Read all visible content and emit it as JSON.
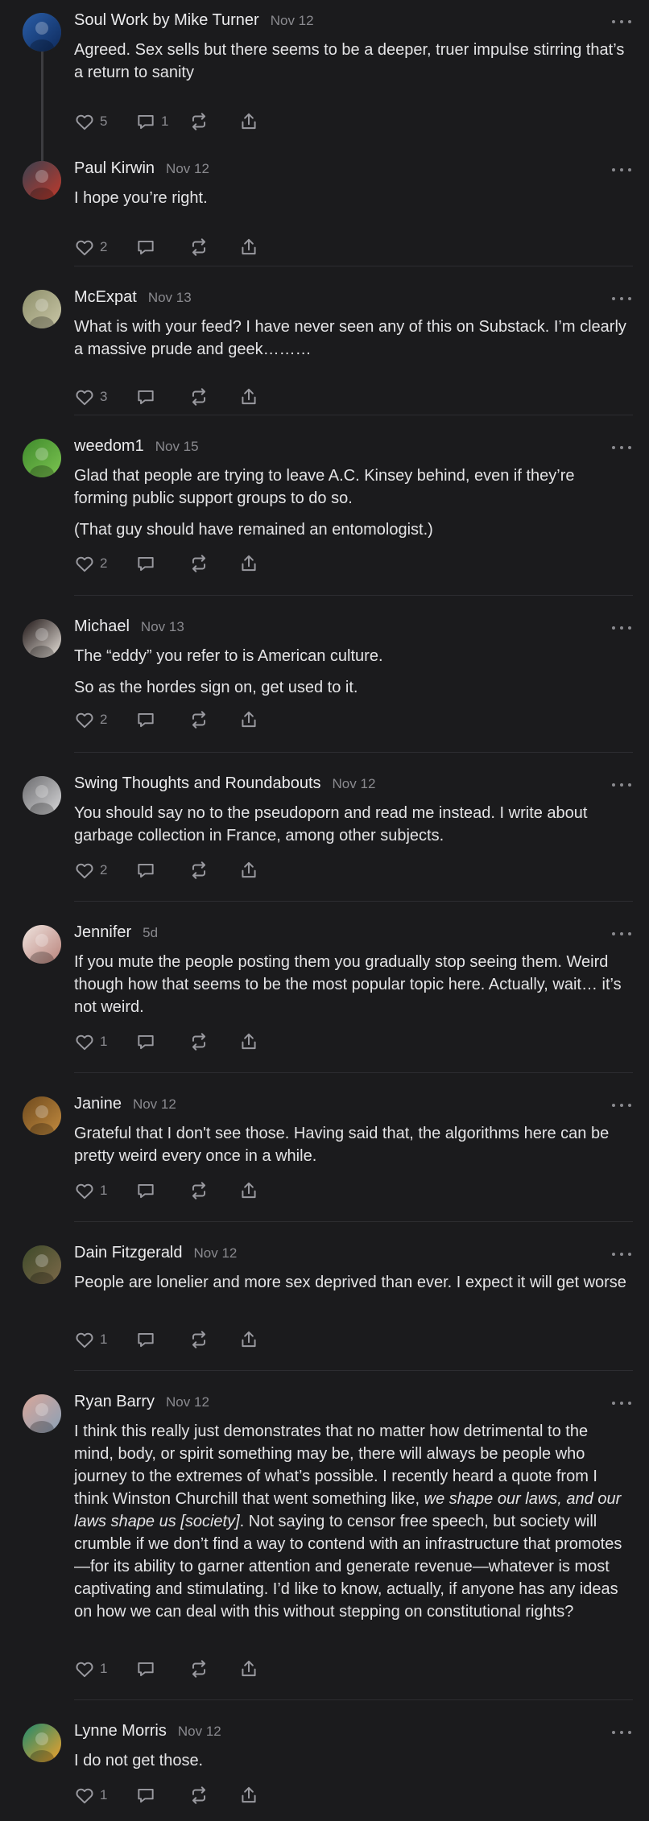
{
  "comments": [
    {
      "author": "Soul Work by Mike Turner",
      "date": "Nov 12",
      "avatar": "avatar-blue-suit",
      "avatar_colors": [
        "#2a5ea8",
        "#0e2a5c"
      ],
      "paragraphs": [
        "Agreed. Sex sells but there seems to be a deeper, truer impulse stirring that’s a return to sanity"
      ],
      "likes": "5",
      "replies": "1"
    },
    {
      "author": "Paul Kirwin",
      "date": "Nov 12",
      "avatar": "avatar-red-figure",
      "avatar_colors": [
        "#3a4150",
        "#c0392b"
      ],
      "paragraphs": [
        "I hope you’re right."
      ],
      "likes": "2",
      "replies": ""
    },
    {
      "author": "McExpat",
      "date": "Nov 13",
      "avatar": "avatar-landscape",
      "avatar_colors": [
        "#8d8f6b",
        "#c9c6a6"
      ],
      "paragraphs": [
        "What is with your feed? I have never seen any of this on Substack. I’m clearly a massive prude and geek………"
      ],
      "likes": "3",
      "replies": ""
    },
    {
      "author": "weedom1",
      "date": "Nov 15",
      "avatar": "avatar-green-leaves",
      "avatar_colors": [
        "#3f8a2c",
        "#7cc451"
      ],
      "paragraphs": [
        "Glad that people are trying to leave A.C. Kinsey behind, even if they’re forming public support groups to do so.",
        "(That guy should have remained an entomologist.)"
      ],
      "likes": "2",
      "replies": ""
    },
    {
      "author": "Michael",
      "date": "Nov 13",
      "avatar": "avatar-piano",
      "avatar_colors": [
        "#1d1414",
        "#e9e3dc"
      ],
      "paragraphs": [
        "The “eddy” you refer to is American culture.",
        "So as the hordes sign on, get used to it."
      ],
      "likes": "2",
      "replies": ""
    },
    {
      "author": "Swing Thoughts and Roundabouts",
      "date": "Nov 12",
      "avatar": "avatar-statue",
      "avatar_colors": [
        "#6b6b6e",
        "#d7d7d9"
      ],
      "paragraphs": [
        "You should say no to the pseudoporn and read me instead. I write about garbage collection in France, among other subjects."
      ],
      "likes": "2",
      "replies": ""
    },
    {
      "author": "Jennifer",
      "date": "5d",
      "avatar": "avatar-woman",
      "avatar_colors": [
        "#efe4df",
        "#b9827a"
      ],
      "paragraphs": [
        "If you mute the people posting them you gradually stop seeing them. Weird though how that seems to be the most popular topic here. Actually, wait… it’s not weird."
      ],
      "likes": "1",
      "replies": ""
    },
    {
      "author": "Janine",
      "date": "Nov 12",
      "avatar": "avatar-bronze-coin",
      "avatar_colors": [
        "#6e4a1e",
        "#c38b3f"
      ],
      "paragraphs": [
        "Grateful that I don't see those. Having said that, the algorithms here can be pretty weird every once in a while."
      ],
      "likes": "1",
      "replies": ""
    },
    {
      "author": "Dain Fitzgerald",
      "date": "Nov 12",
      "avatar": "avatar-forest-man",
      "avatar_colors": [
        "#3e4a2a",
        "#7d6a4a"
      ],
      "paragraphs": [
        "People are lonelier and more sex deprived than ever. I expect it will get worse"
      ],
      "likes": "1",
      "replies": ""
    },
    {
      "author": "Ryan Barry",
      "date": "Nov 12",
      "avatar": "avatar-man-pink",
      "avatar_colors": [
        "#d9a79a",
        "#8aa0b6"
      ],
      "paragraphs": [
        [
          {
            "text": "I think this really just demonstrates that no matter how detrimental to the mind, body, or spirit something may be, there will always be people who journey to the extremes of what’s possible. I recently heard a quote from I think Winston Churchill that went something like, ",
            "italic": false
          },
          {
            "text": "we shape our laws, and our laws shape us [society]",
            "italic": true
          },
          {
            "text": ". Not saying to censor free speech, but society will crumble if we don’t find a way to contend with an infrastructure that promotes—for its ability to garner attention and generate revenue—whatever is most captivating and stimulating. I’d like to know, actually, if anyone has any ideas on how we can deal with this without stepping on constitutional rights?",
            "italic": false
          }
        ]
      ],
      "likes": "1",
      "replies": ""
    },
    {
      "author": "Lynne Morris",
      "date": "Nov 12",
      "avatar": "avatar-teal-circle",
      "avatar_colors": [
        "#1e8a6e",
        "#f0a12b"
      ],
      "paragraphs": [
        "I do not get those."
      ],
      "likes": "1",
      "replies": ""
    }
  ],
  "icons": {
    "like": "heart-icon",
    "reply": "comment-bubble-icon",
    "restack": "restack-icon",
    "share": "share-icon",
    "more": "more-options-icon"
  },
  "colors": {
    "background": "#1b1b1d",
    "text": "#e4e4e6",
    "muted": "#8a8a8f",
    "icon": "#9a9aa0",
    "divider": "#2d2d31"
  }
}
